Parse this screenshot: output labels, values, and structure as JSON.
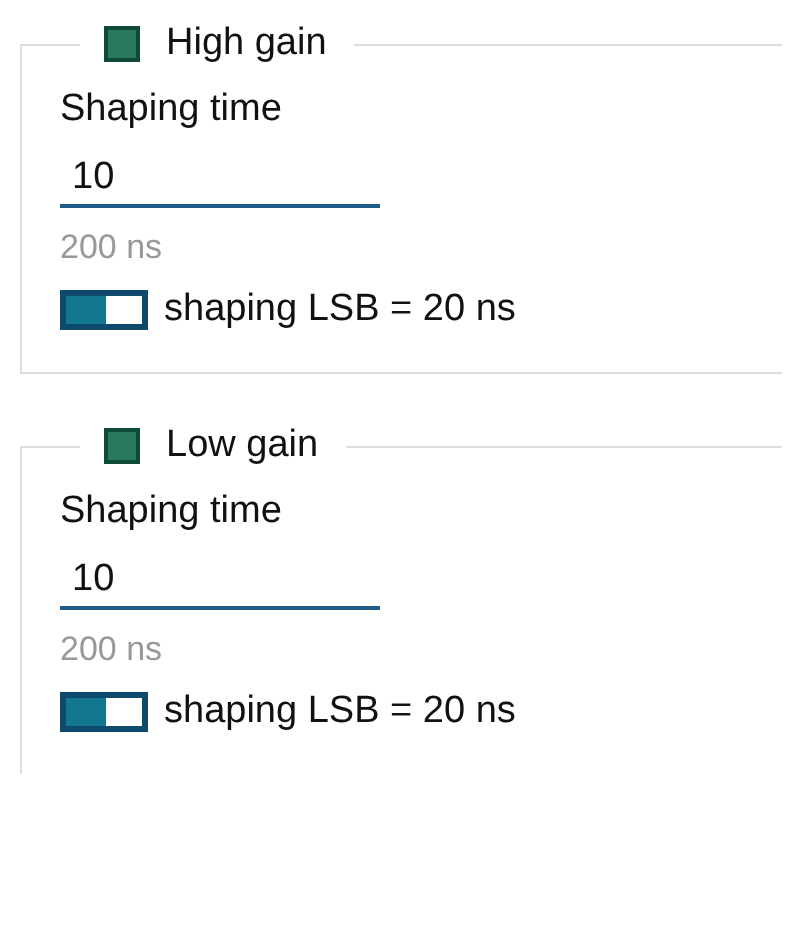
{
  "groups": [
    {
      "title": "High gain",
      "checked": true,
      "label": "Shaping time",
      "value": "10",
      "hint": "200 ns",
      "toggle": {
        "on": true,
        "label": "shaping LSB = 20 ns"
      }
    },
    {
      "title": "Low gain",
      "checked": true,
      "label": "Shaping time",
      "value": "10",
      "hint": "200 ns",
      "toggle": {
        "on": true,
        "label": "shaping LSB = 20 ns"
      }
    }
  ]
}
